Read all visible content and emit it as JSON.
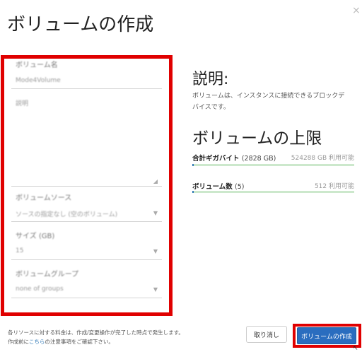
{
  "dialog": {
    "title": "ボリュームの作成",
    "close_label": "×"
  },
  "form": {
    "name_label": "ボリューム名",
    "name_value": "Mode4Volume",
    "desc_value": "説明",
    "source_label": "ボリュームソース",
    "source_value": "ソースの指定なし (空のボリューム)",
    "size_label": "サイズ (GB)",
    "size_value": "15",
    "group_label": "ボリュームグループ",
    "group_value": "none of groups"
  },
  "info": {
    "desc_heading": "説明:",
    "desc_text": "ボリュームは、インスタンスに接続できるブロックデバイスです。",
    "limits_heading": "ボリュームの上限",
    "limits": [
      {
        "name": "合計ギガバイト",
        "detail": "(2828 GB)",
        "available": "524288 GB 利用可能",
        "used_fraction": 0.0054
      },
      {
        "name": "ボリューム数",
        "detail": "(5)",
        "available": "512 利用可能",
        "used_fraction": 0.0098
      }
    ]
  },
  "footer": {
    "note_line1": "各リソースに対する料金は、作成/変更操作が完了した時点で発生します。",
    "note_line2_prefix": "作成前に",
    "note_link": "こちら",
    "note_line2_suffix": "の注意事項をご確認下さい。",
    "cancel_label": "取り消し",
    "create_label": "ボリュームの作成"
  },
  "colors": {
    "accent": "#2a6dbf",
    "highlight": "#e00000",
    "bar_bg": "#cce8cc"
  }
}
